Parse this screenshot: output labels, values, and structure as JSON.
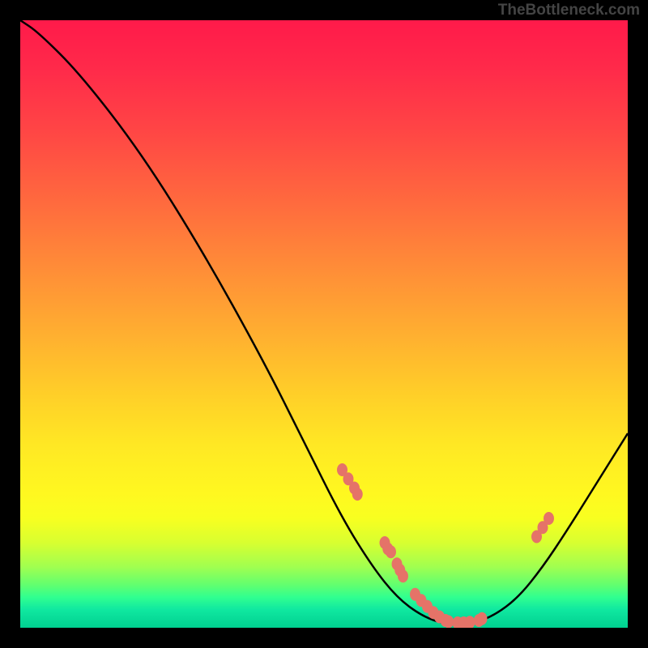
{
  "watermark": "TheBottleneck.com",
  "chart_data": {
    "type": "line",
    "title": "",
    "xlabel": "",
    "ylabel": "",
    "xlim": [
      0,
      100
    ],
    "ylim": [
      0,
      100
    ],
    "curve": [
      {
        "x": 0,
        "y": 100
      },
      {
        "x": 3,
        "y": 98
      },
      {
        "x": 10,
        "y": 91
      },
      {
        "x": 20,
        "y": 78
      },
      {
        "x": 30,
        "y": 62
      },
      {
        "x": 40,
        "y": 44
      },
      {
        "x": 47,
        "y": 30
      },
      {
        "x": 53,
        "y": 18
      },
      {
        "x": 58,
        "y": 10
      },
      {
        "x": 62,
        "y": 5
      },
      {
        "x": 66,
        "y": 2
      },
      {
        "x": 70,
        "y": 0.5
      },
      {
        "x": 74,
        "y": 0.5
      },
      {
        "x": 78,
        "y": 2
      },
      {
        "x": 82,
        "y": 5
      },
      {
        "x": 86,
        "y": 10
      },
      {
        "x": 90,
        "y": 16
      },
      {
        "x": 95,
        "y": 24
      },
      {
        "x": 100,
        "y": 32
      }
    ],
    "markers": [
      {
        "x": 53,
        "y": 26
      },
      {
        "x": 54,
        "y": 24.5
      },
      {
        "x": 55,
        "y": 23
      },
      {
        "x": 55.5,
        "y": 22
      },
      {
        "x": 60,
        "y": 14
      },
      {
        "x": 60.5,
        "y": 13
      },
      {
        "x": 61,
        "y": 12.5
      },
      {
        "x": 62,
        "y": 10.5
      },
      {
        "x": 62.5,
        "y": 9.5
      },
      {
        "x": 63,
        "y": 8.5
      },
      {
        "x": 65,
        "y": 5.5
      },
      {
        "x": 66,
        "y": 4.5
      },
      {
        "x": 67,
        "y": 3.5
      },
      {
        "x": 68,
        "y": 2.5
      },
      {
        "x": 69,
        "y": 1.8
      },
      {
        "x": 70,
        "y": 1.2
      },
      {
        "x": 70.5,
        "y": 1
      },
      {
        "x": 72,
        "y": 0.8
      },
      {
        "x": 73,
        "y": 0.8
      },
      {
        "x": 74,
        "y": 0.9
      },
      {
        "x": 75.5,
        "y": 1.2
      },
      {
        "x": 76,
        "y": 1.5
      },
      {
        "x": 85,
        "y": 15
      },
      {
        "x": 86,
        "y": 16.5
      },
      {
        "x": 87,
        "y": 18
      }
    ],
    "marker_color": "#e57368"
  }
}
